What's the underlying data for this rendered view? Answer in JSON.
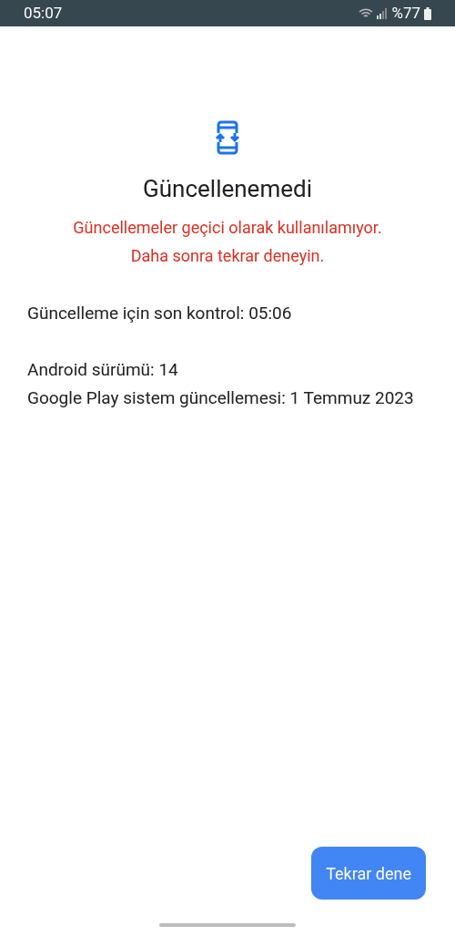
{
  "status_bar": {
    "time": "05:07",
    "battery": "%77"
  },
  "title": "Güncellenemedi",
  "error_lines": [
    "Güncellemeler geçici olarak kullanılamıyor.",
    "Daha sonra tekrar deneyin."
  ],
  "last_check": "Güncelleme için son kontrol: 05:06",
  "info_lines": [
    "Android sürümü: 14",
    "Google Play sistem güncellemesi: 1 Temmuz 2023"
  ],
  "retry_button": "Tekrar dene"
}
